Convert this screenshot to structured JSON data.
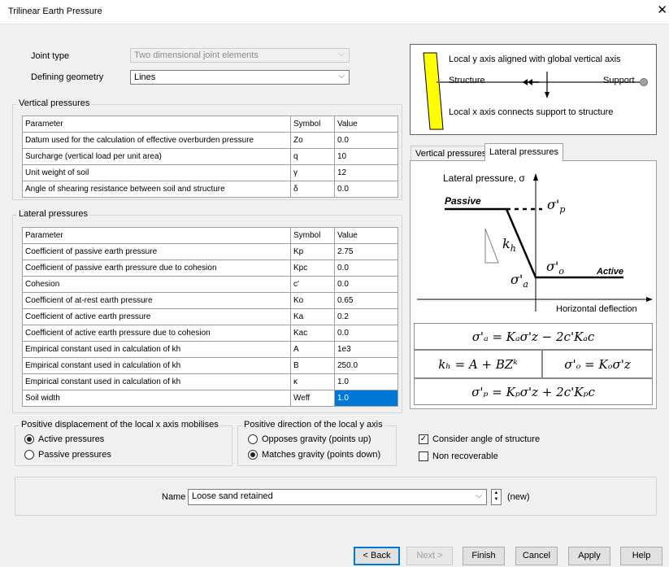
{
  "window": {
    "title": "Trilinear Earth Pressure",
    "close_glyph": "✕"
  },
  "joint": {
    "joint_type_label": "Joint type",
    "joint_type_value": "Two dimensional joint elements",
    "geometry_label": "Defining geometry",
    "geometry_value": "Lines"
  },
  "vertical": {
    "group_label": "Vertical pressures",
    "headers": [
      "Parameter",
      "Symbol",
      "Value"
    ],
    "rows": [
      [
        "Datum used for the calculation of effective overburden pressure",
        "Zo",
        "0.0"
      ],
      [
        "Surcharge (vertical load per unit area)",
        "q",
        "10"
      ],
      [
        "Unit weight of soil",
        "γ",
        "12"
      ],
      [
        "Angle of shearing resistance between soil and structure",
        "δ",
        "0.0"
      ]
    ]
  },
  "lateral": {
    "group_label": "Lateral pressures",
    "headers": [
      "Parameter",
      "Symbol",
      "Value"
    ],
    "rows": [
      [
        "Coefficient of passive earth pressure",
        "Kp",
        "2.75"
      ],
      [
        "Coefficient of passive earth pressure due to cohesion",
        "Kpc",
        "0.0"
      ],
      [
        "Cohesion",
        "c'",
        "0.0"
      ],
      [
        "Coefficient of at-rest earth pressure",
        "Ko",
        "0.65"
      ],
      [
        "Coefficient of active earth pressure",
        "Ka",
        "0.2"
      ],
      [
        "Coefficient of active earth pressure due to cohesion",
        "Kac",
        "0.0"
      ],
      [
        "Empirical constant used in calculation of kh",
        "A",
        "1e3"
      ],
      [
        "Empirical constant used in calculation of kh",
        "B",
        "250.0"
      ],
      [
        "Empirical constant used in calculation of kh",
        "κ",
        "1.0"
      ],
      [
        "Soil width",
        "Weff",
        "1.0"
      ]
    ]
  },
  "axes_diagram": {
    "top_text": "Local y axis aligned with global vertical axis",
    "structure_label": "Structure",
    "support_label": "Support",
    "bottom_text": "Local x axis connects support to structure"
  },
  "tabs": [
    "Vertical pressures",
    "Lateral pressures"
  ],
  "graph": {
    "y_axis_label": "Lateral pressure, σ",
    "x_axis_label": "Horizontal deflection",
    "passive_label": "Passive",
    "active_label": "Active",
    "sigma_p": "σ'",
    "sigma_p_sub": "p",
    "sigma_o": "σ'",
    "sigma_o_sub": "o",
    "sigma_a": "σ'",
    "sigma_a_sub": "a",
    "kh": "k",
    "kh_sub": "h"
  },
  "formulas": {
    "f1": "σ'ₐ = Kₐσ'z − 2c'Kₐc",
    "f2": "kₕ = A + BZᵏ",
    "f3": "σ'ₒ = Kₒσ'z",
    "f4": "σ'ₚ = Kₚσ'z + 2c'Kₚc"
  },
  "displacement": {
    "group_label": "Positive displacement of the local x axis mobilises",
    "opt1": "Active pressures",
    "opt2": "Passive pressures",
    "selected": "Active pressures"
  },
  "direction": {
    "group_label": "Positive direction of the local y axis",
    "opt1": "Opposes gravity (points up)",
    "opt2": "Matches gravity (points down)",
    "selected": "Matches gravity (points down)"
  },
  "options": {
    "consider_angle": "Consider angle of structure",
    "consider_angle_checked": true,
    "non_recoverable": "Non recoverable",
    "non_recoverable_checked": false
  },
  "name_row": {
    "label": "Name",
    "value": "Loose sand retained",
    "status": "(new)"
  },
  "buttons": {
    "back": "< Back",
    "next": "Next >",
    "finish": "Finish",
    "cancel": "Cancel",
    "apply": "Apply",
    "help": "Help"
  },
  "colors": {
    "selection": "#0078d7",
    "structure": "#ffff00",
    "support_node": "#a0a0a0"
  }
}
